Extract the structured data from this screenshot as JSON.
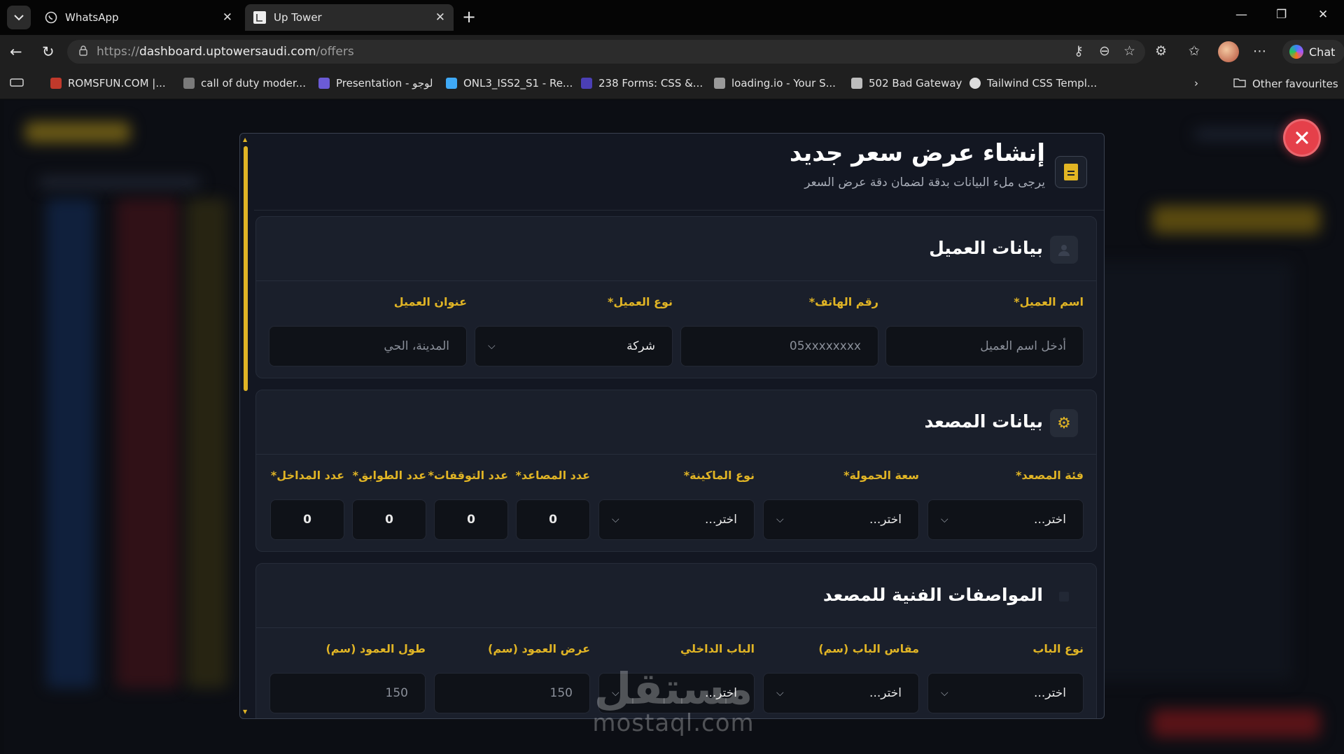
{
  "browser": {
    "tabs": [
      {
        "title": "WhatsApp",
        "favicon": "whatsapp-icon",
        "active": false
      },
      {
        "title": "Up Tower",
        "favicon": "uptower-icon",
        "active": true
      }
    ],
    "url_prefix": "https://",
    "url_host": "dashboard.uptowersaudi.com",
    "url_path": "/offers",
    "chat_label": "Chat",
    "bookmarks": [
      {
        "label": "ROMSFUN.COM |...",
        "color": "#c0392b"
      },
      {
        "label": "call of duty moder...",
        "color": "#7a7a7a"
      },
      {
        "label": "Presentation - لوجو",
        "color": "#6b5bd6"
      },
      {
        "label": "ONL3_ISS2_S1 - Re...",
        "color": "#3fa9f5"
      },
      {
        "label": "238 Forms: CSS &...",
        "color": "#4b3fb5"
      },
      {
        "label": "loading.io - Your S...",
        "color": "#9a9a9a"
      },
      {
        "label": "502 Bad Gateway",
        "color": "#bdbdbd"
      },
      {
        "label": "Tailwind CSS Templ...",
        "color": "#dddddd"
      }
    ],
    "other_favourites": "Other favourites"
  },
  "modal": {
    "title": "إنشاء عرض سعر جديد",
    "subtitle": "يرجى ملء البيانات بدقة لضمان دقة عرض السعر",
    "icon": "document-icon"
  },
  "client_section": {
    "title": "بيانات العميل",
    "icon": "user-icon",
    "fields": {
      "name": {
        "label": "اسم العميل*",
        "placeholder": "أدخل اسم العميل"
      },
      "phone": {
        "label": "رقم الهاتف*",
        "placeholder": "05xxxxxxxx"
      },
      "type": {
        "label": "نوع العميل*",
        "value": "شركة"
      },
      "address": {
        "label": "عنوان العميل",
        "placeholder": "المدينة، الحي"
      }
    }
  },
  "elevator_section": {
    "title": "بيانات المصعد",
    "icon": "gear-icon",
    "fields": {
      "category": {
        "label": "فئة المصعد*",
        "value": "اختر..."
      },
      "capacity": {
        "label": "سعة الحمولة*",
        "value": "اختر..."
      },
      "machine": {
        "label": "نوع الماكينة*",
        "value": "اختر..."
      },
      "elevators": {
        "label": "عدد المصاعد*",
        "value": "0"
      },
      "stops": {
        "label": "عدد التوقفات*",
        "value": "0"
      },
      "floors": {
        "label": "عدد الطوابق*",
        "value": "0"
      },
      "entrances": {
        "label": "عدد المداخل*",
        "value": "0"
      }
    }
  },
  "specs_section": {
    "title": "المواصفات الفنية للمصعد",
    "fields": {
      "door_type": {
        "label": "نوع الباب",
        "value": "اختر..."
      },
      "door_size": {
        "label": "مقاس الباب (سم)",
        "value": "اختر..."
      },
      "inner_door": {
        "label": "الباب الداخلي",
        "value": "اختر..."
      },
      "column_width": {
        "label": "عرض العمود (سم)",
        "value": "150"
      },
      "column_length": {
        "label": "طول العمود (سم)",
        "value": "150"
      }
    }
  },
  "watermark": {
    "arabic": "مستقل",
    "latin": "mostaql.com"
  },
  "colors": {
    "accent": "#e0b425",
    "danger": "#e5404a",
    "panel": "#1a1f2b"
  }
}
